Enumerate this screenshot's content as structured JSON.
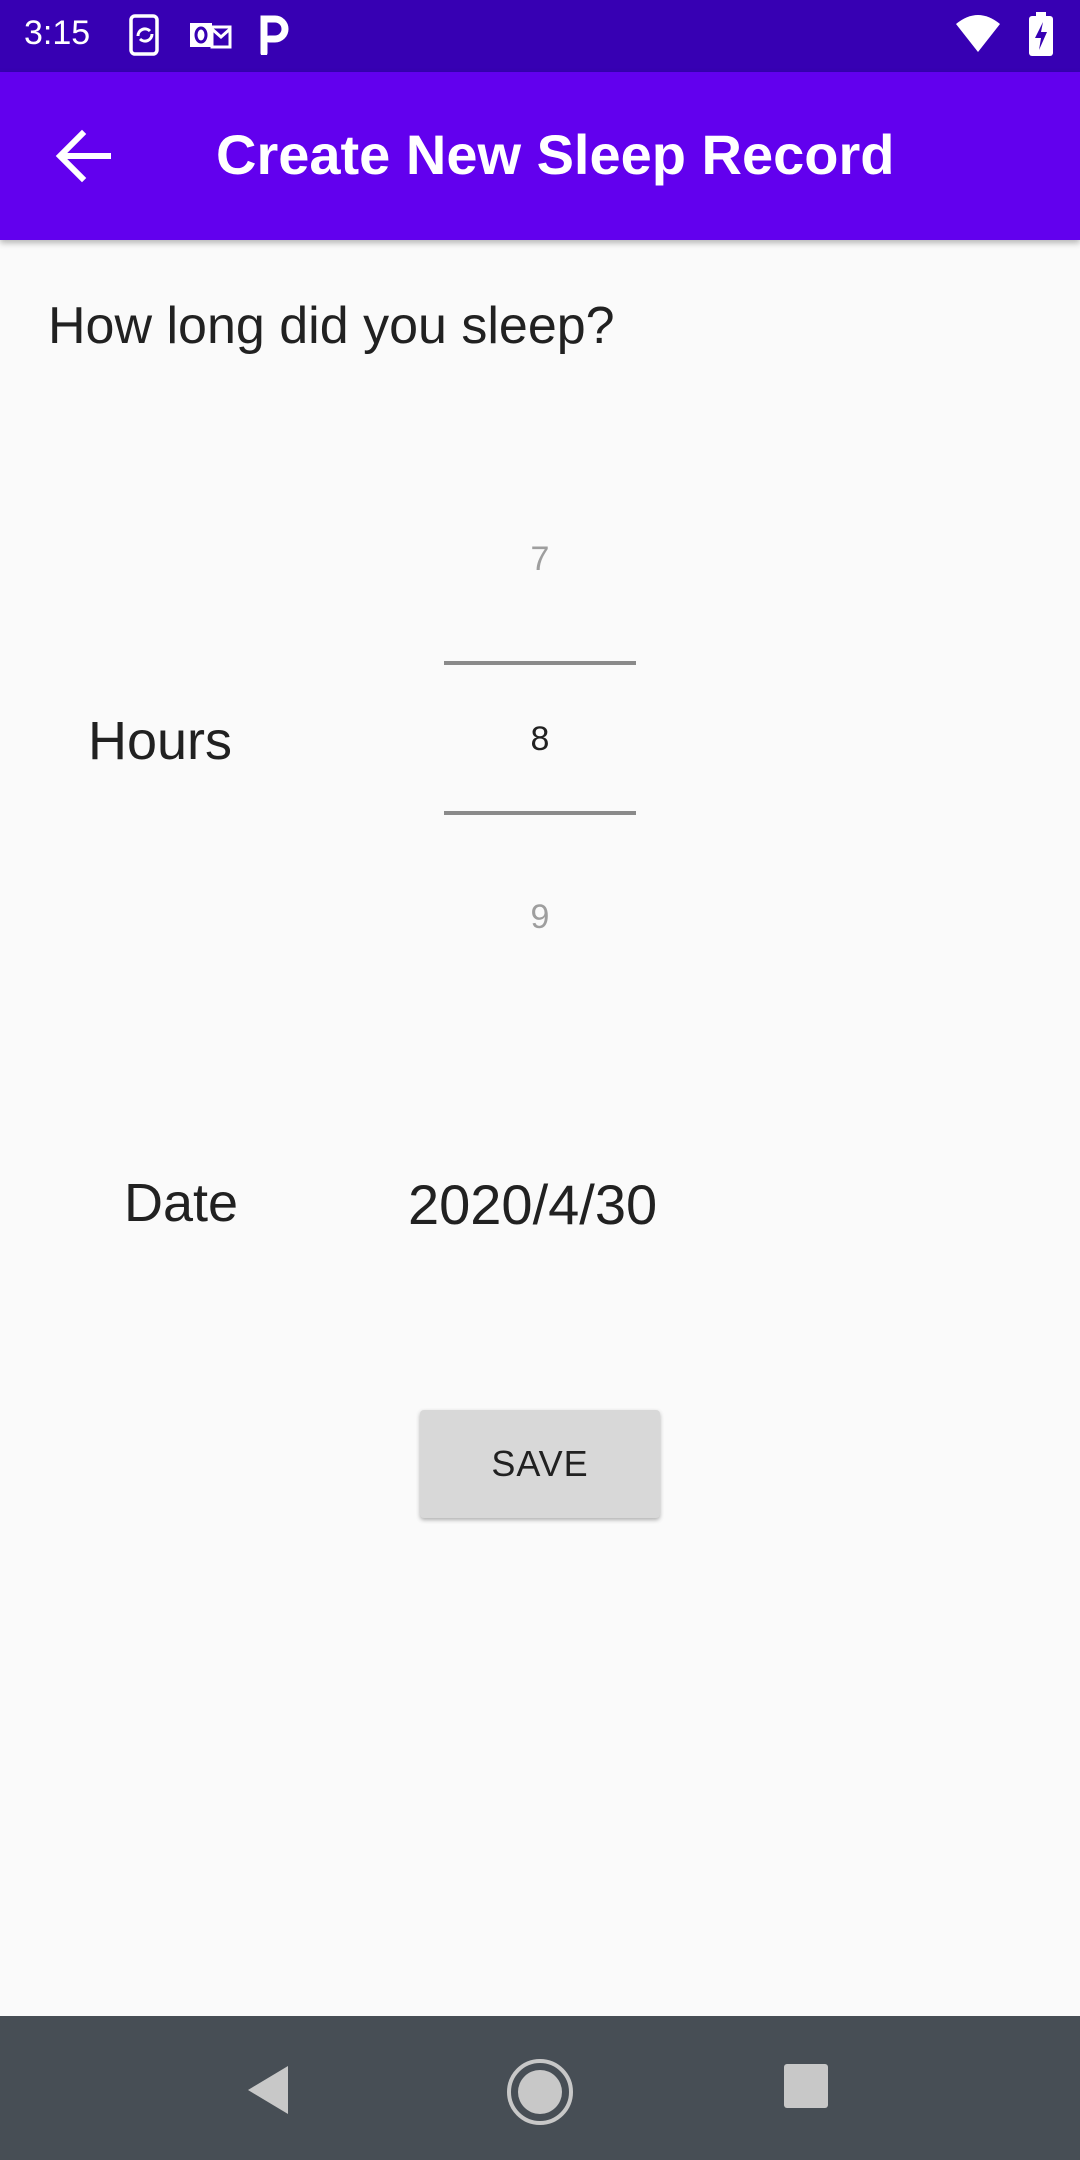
{
  "status_bar": {
    "time": "3:15",
    "left_icons": [
      "phone-sync-icon",
      "outlook-icon",
      "parking-icon"
    ],
    "right_icons": [
      "wifi-icon",
      "battery-charging-icon"
    ]
  },
  "app_bar": {
    "title": "Create New Sleep Record",
    "back_icon": "arrow-back-icon"
  },
  "question": "How long did you sleep?",
  "hours": {
    "label": "Hours",
    "picker": {
      "previous": "7",
      "selected": "8",
      "next": "9"
    }
  },
  "date": {
    "label": "Date",
    "value": "2020/4/30"
  },
  "save_button": {
    "label": "SAVE"
  },
  "nav_bar": {
    "icons": [
      "nav-back-icon",
      "nav-home-icon",
      "nav-recents-icon"
    ]
  },
  "colors": {
    "status_bar": "#3700b3",
    "app_bar": "#6200ee",
    "background": "#fafafa",
    "nav_bar": "#474e55",
    "button": "#d8d8d8"
  }
}
